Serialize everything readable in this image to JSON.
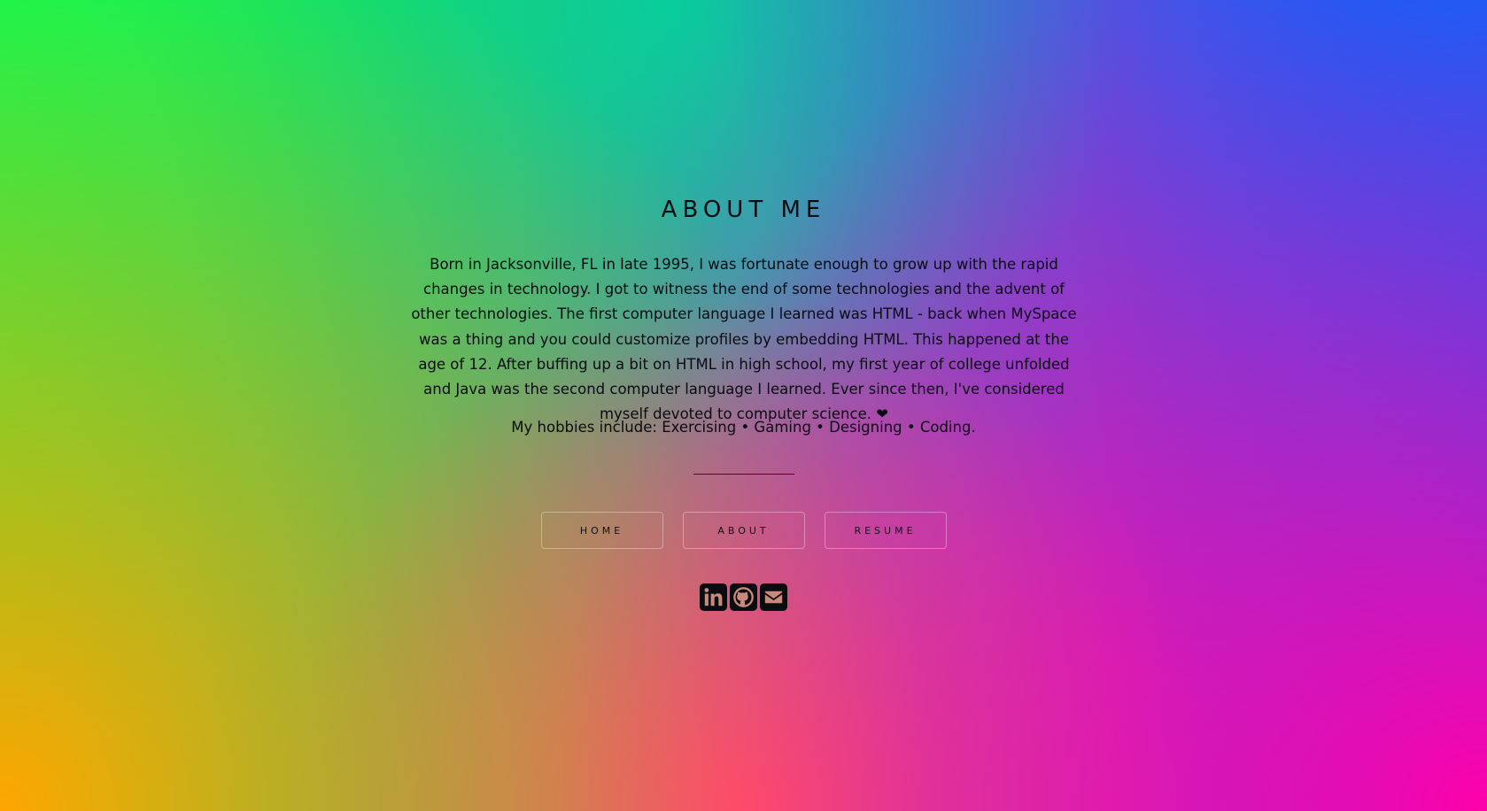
{
  "page": {
    "title": "ABOUT ME",
    "bio": "Born in Jacksonville, FL in late 1995, I was fortunate enough to grow up with the rapid changes in technology. I got to witness the end of some technologies and the advent of other technologies. The first computer language I learned was HTML - back when MySpace was a thing and you could customize profiles by embedding HTML. This happened at the age of 12. After buffing up a bit on HTML in high school, my first year of college unfolded and Java was the second computer language I learned. Ever since then, I've considered myself devoted to computer science.",
    "heart": "❤",
    "hobbies": "My hobbies include: Exercising • Gaming • Designing • Coding."
  },
  "nav": {
    "home": "HOME",
    "about": "ABOUT",
    "resume": "RESUME"
  },
  "socials": [
    {
      "icon": "linkedin-icon"
    },
    {
      "icon": "github-icon"
    },
    {
      "icon": "envelope-icon"
    }
  ],
  "colors": {
    "top_left": "#00ff55",
    "top_right": "#0066ff",
    "bottom_left": "#ffa500",
    "bottom_right": "#ff00aa",
    "text": "#0b0b12"
  }
}
